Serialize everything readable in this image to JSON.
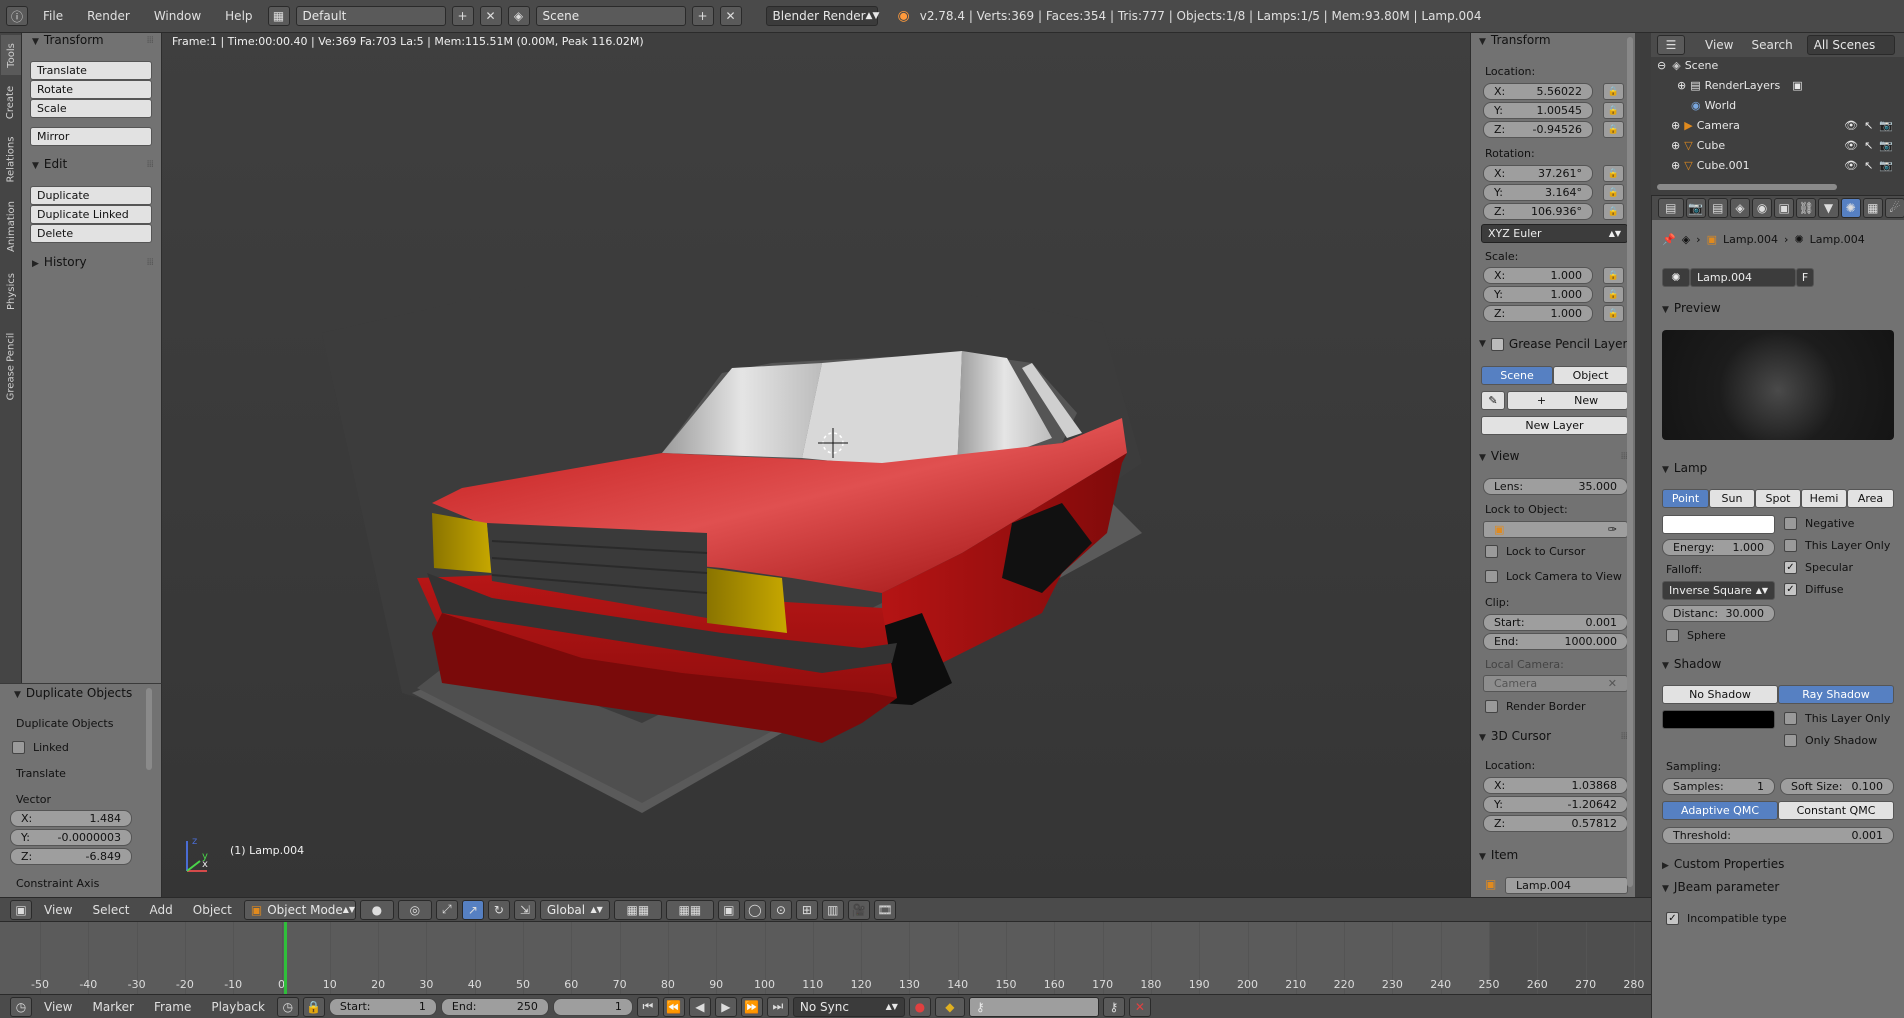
{
  "topbar": {
    "menus": [
      "File",
      "Render",
      "Window",
      "Help"
    ],
    "layout": "Default",
    "scene": "Scene",
    "engine": "Blender Render",
    "stats": "v2.78.4 | Verts:369 | Faces:354 | Tris:777 | Objects:1/8 | Lamps:1/5 | Mem:93.80M | Lamp.004"
  },
  "side_tabs": [
    "Tools",
    "Create",
    "Relations",
    "Animation",
    "Physics",
    "Grease Pencil"
  ],
  "tools": {
    "transform_title": "Transform",
    "transform_buttons": [
      "Translate",
      "Rotate",
      "Scale"
    ],
    "mirror": "Mirror",
    "edit_title": "Edit",
    "edit_buttons": [
      "Duplicate",
      "Duplicate Linked",
      "Delete"
    ],
    "history_title": "History"
  },
  "operator": {
    "title": "Duplicate Objects",
    "subtitle": "Duplicate Objects",
    "linked": "Linked",
    "translate": "Translate",
    "vector": "Vector",
    "x_label": "X:",
    "x": "1.484",
    "y_label": "Y:",
    "y": "-0.0000003",
    "z_label": "Z:",
    "z": "-6.849",
    "constraint": "Constraint Axis"
  },
  "viewport": {
    "status": "Frame:1 | Time:00:00.40 | Ve:369 Fa:703 La:5 | Mem:115.51M (0.00M, Peak 116.02M)",
    "selected": "(1) Lamp.004",
    "axis_x": "x",
    "axis_y": "y"
  },
  "header3d": {
    "menus": [
      "View",
      "Select",
      "Add",
      "Object"
    ],
    "mode": "Object Mode",
    "orientation": "Global"
  },
  "props": {
    "transform_title": "Transform",
    "location_label": "Location:",
    "loc_x": "5.56022",
    "loc_y": "1.00545",
    "loc_z": "-0.94526",
    "rotation_label": "Rotation:",
    "rot_x": "37.261°",
    "rot_y": "3.164°",
    "rot_z": "106.936°",
    "rot_mode": "XYZ Euler",
    "scale_label": "Scale:",
    "scale_x": "1.000",
    "scale_y": "1.000",
    "scale_z": "1.000",
    "gp_title": "Grease Pencil Layers",
    "gp_scene": "Scene",
    "gp_object": "Object",
    "gp_new": "New",
    "gp_new_layer": "New Layer",
    "view_title": "View",
    "lens_label": "Lens:",
    "lens": "35.000",
    "lock_object": "Lock to Object:",
    "lock_cursor": "Lock to Cursor",
    "lock_camera": "Lock Camera to View",
    "clip_label": "Clip:",
    "clip_start_label": "Start:",
    "clip_start": "0.001",
    "clip_end_label": "End:",
    "clip_end": "1000.000",
    "local_camera": "Local Camera:",
    "camera": "Camera",
    "render_border": "Render Border",
    "cursor_title": "3D Cursor",
    "cursor_location": "Location:",
    "cur_x": "1.03868",
    "cur_y": "-1.20642",
    "cur_z": "0.57812",
    "item_title": "Item",
    "item_name": "Lamp.004",
    "x": "X:",
    "y": "Y:",
    "z": "Z:"
  },
  "outliner": {
    "menus": [
      "View",
      "Search"
    ],
    "filter": "All Scenes",
    "rows": [
      "Scene",
      "RenderLayers",
      "World",
      "Camera",
      "Cube",
      "Cube.001"
    ]
  },
  "properties_editor": {
    "breadcrumb_1": "Lamp.004",
    "breadcrumb_2": "Lamp.004",
    "datablock": "Lamp.004",
    "f_label": "F",
    "preview_title": "Preview",
    "lamp_title": "Lamp",
    "lamp_types": [
      "Point",
      "Sun",
      "Spot",
      "Hemi",
      "Area"
    ],
    "negative": "Negative",
    "this_layer_only": "This Layer Only",
    "specular": "Specular",
    "diffuse": "Diffuse",
    "energy_label": "Energy:",
    "energy": "1.000",
    "falloff_label": "Falloff:",
    "falloff": "Inverse Square",
    "distance_label": "Distanc:",
    "distance": "30.000",
    "sphere": "Sphere",
    "shadow_title": "Shadow",
    "no_shadow": "No Shadow",
    "ray_shadow": "Ray Shadow",
    "shadow_layer_only": "This Layer Only",
    "only_shadow": "Only Shadow",
    "sampling": "Sampling:",
    "samples_label": "Samples:",
    "samples": "1",
    "soft_label": "Soft Size:",
    "soft": "0.100",
    "adaptive": "Adaptive QMC",
    "constant": "Constant QMC",
    "threshold_label": "Threshold:",
    "threshold": "0.001",
    "custom_props": "Custom Properties",
    "jbeam": "JBeam parameter",
    "incompatible": "Incompatible type"
  },
  "timeline": {
    "ticks": [
      "-50",
      "-40",
      "-30",
      "-20",
      "-10",
      "0",
      "10",
      "20",
      "30",
      "40",
      "50",
      "60",
      "70",
      "80",
      "90",
      "100",
      "110",
      "120",
      "130",
      "140",
      "150",
      "160",
      "170",
      "180",
      "190",
      "200",
      "210",
      "220",
      "230",
      "240",
      "250",
      "260",
      "270",
      "280"
    ],
    "menus": [
      "View",
      "Marker",
      "Frame",
      "Playback"
    ],
    "start_label": "Start:",
    "start": "1",
    "end_label": "End:",
    "end": "250",
    "current": "1",
    "sync": "No Sync"
  },
  "colors": {
    "car_body": "#a01010",
    "headlight": "#b59a00",
    "selection": "#5680c2",
    "current_frame": "#2fbf3a"
  }
}
